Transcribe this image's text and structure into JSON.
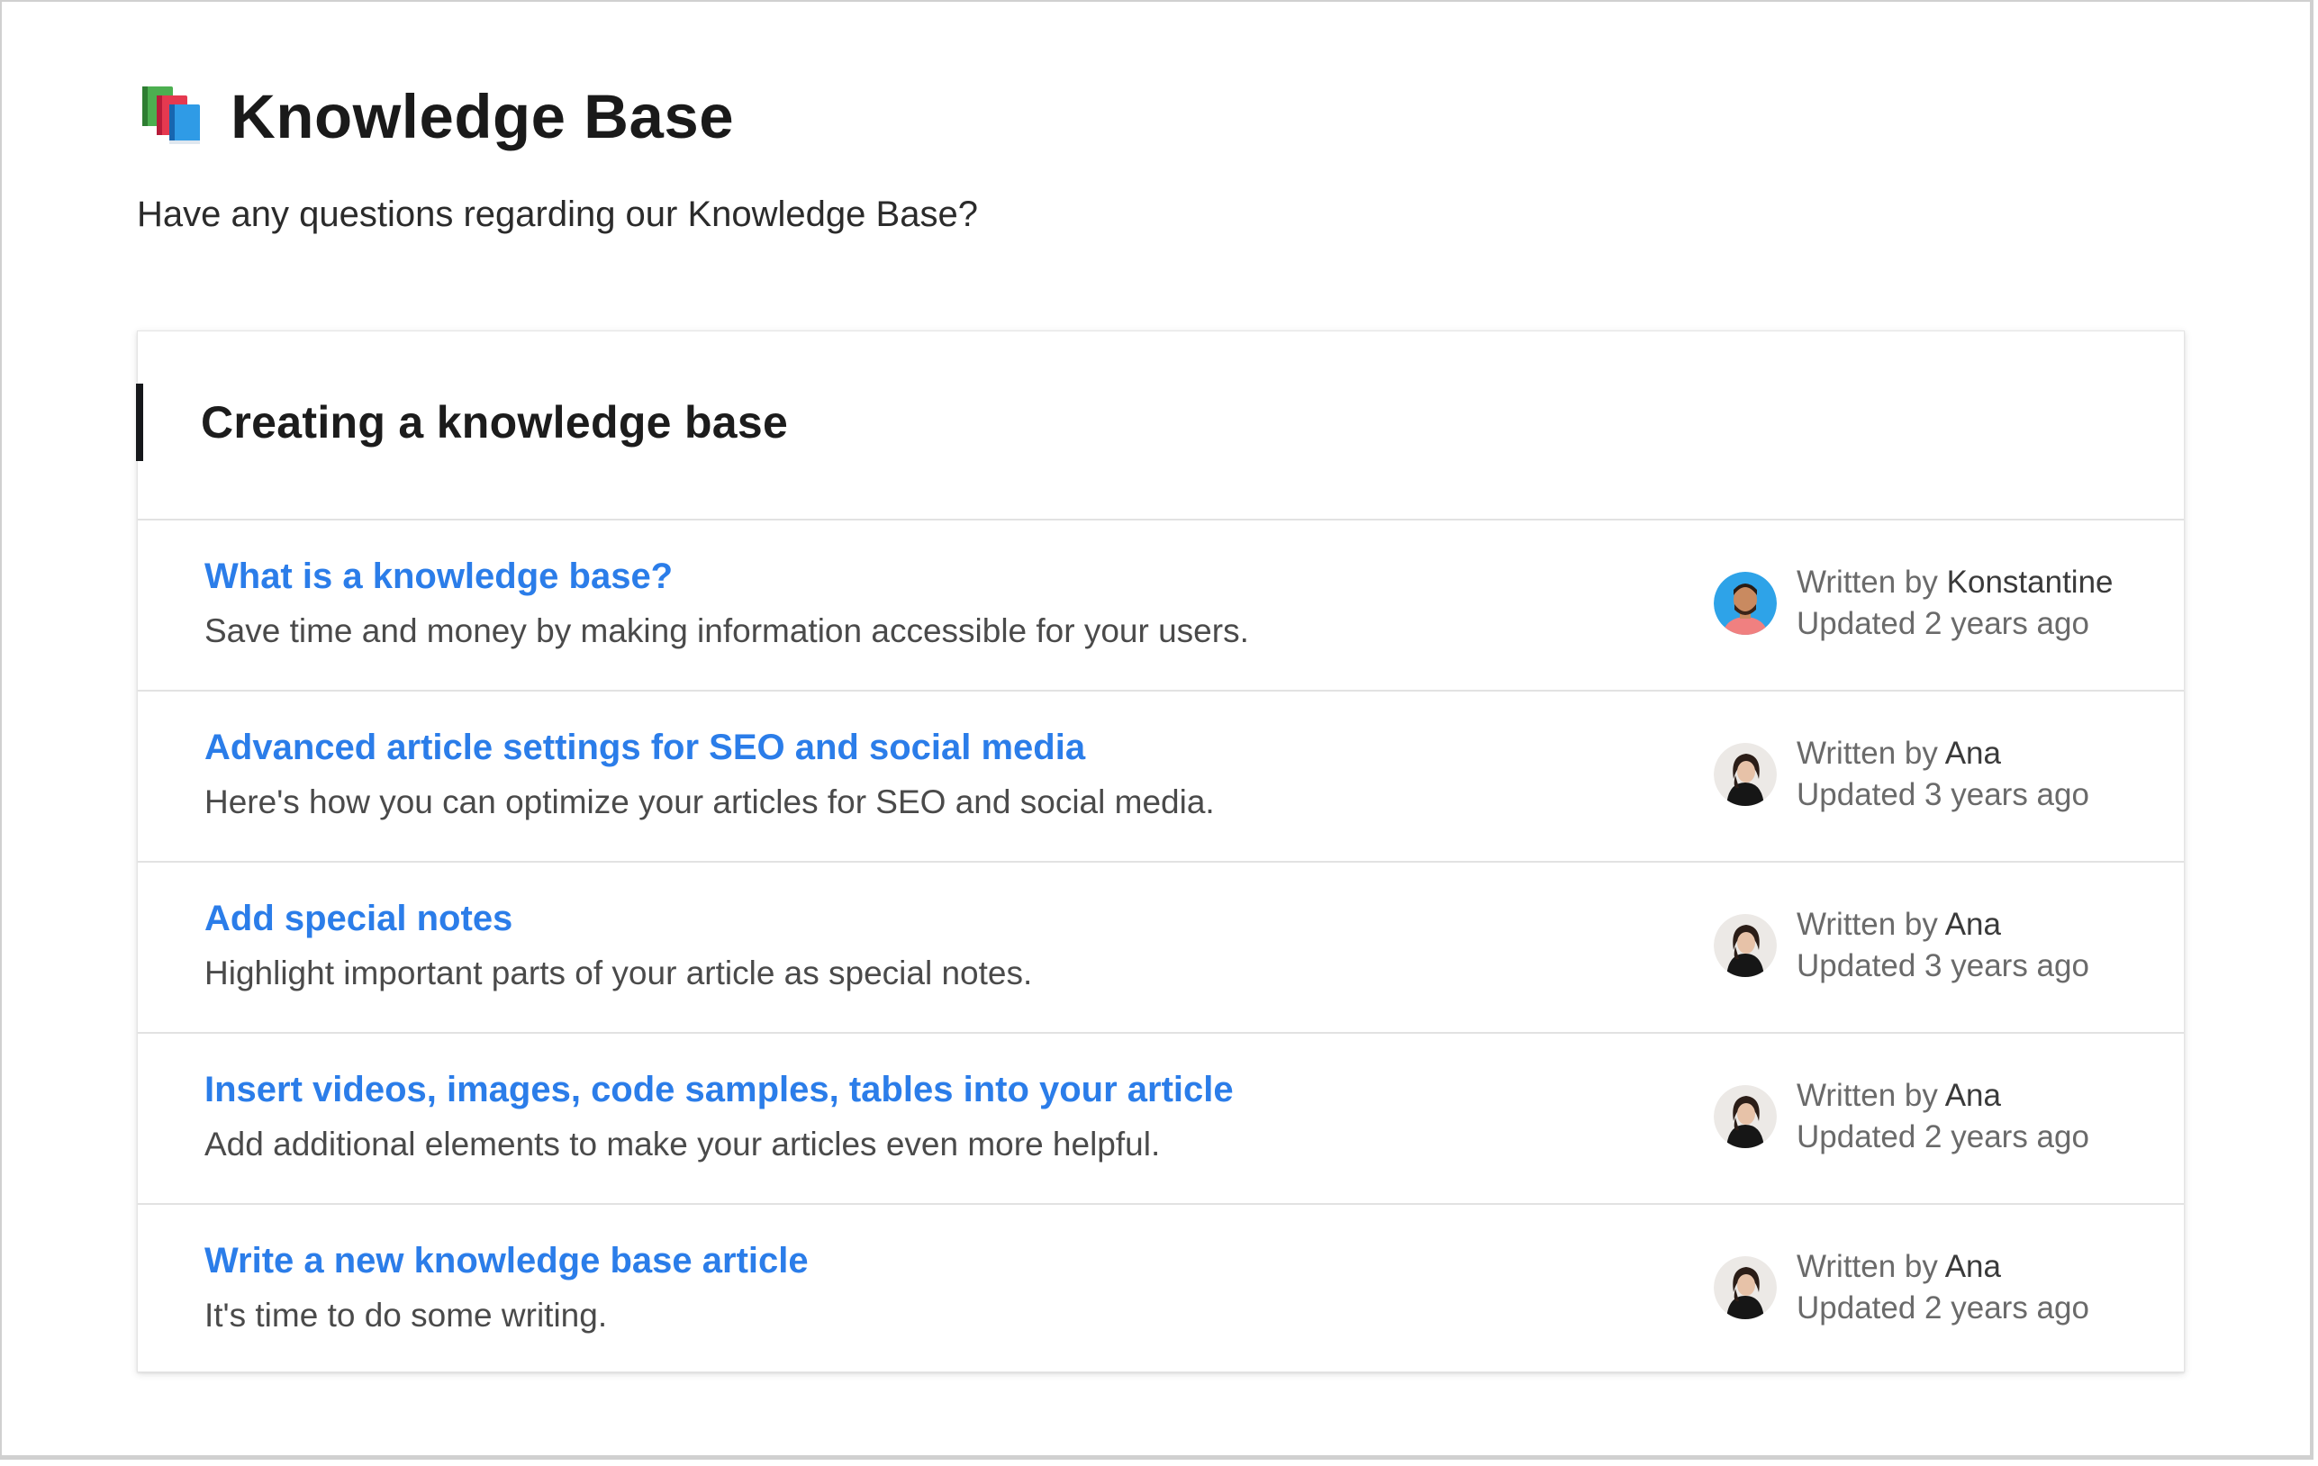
{
  "page": {
    "title": "Knowledge Base",
    "subtitle": "Have any questions regarding our Knowledge Base?",
    "icon": "books-icon"
  },
  "section": {
    "title": "Creating a knowledge base"
  },
  "articles": [
    {
      "title": "What is a knowledge base?",
      "description": "Save time and money by making information accessible for your users.",
      "written_by_label": "Written by",
      "author": "Konstantine",
      "updated": "Updated 2 years ago",
      "avatar": "avatar-konstantine"
    },
    {
      "title": "Advanced article settings for SEO and social media",
      "description": "Here's how you can optimize your articles for SEO and social media.",
      "written_by_label": "Written by",
      "author": "Ana",
      "updated": "Updated 3 years ago",
      "avatar": "avatar-ana"
    },
    {
      "title": "Add special notes",
      "description": "Highlight important parts of your article as special notes.",
      "written_by_label": "Written by",
      "author": "Ana",
      "updated": "Updated 3 years ago",
      "avatar": "avatar-ana"
    },
    {
      "title": "Insert videos, images, code samples, tables into your article",
      "description": "Add additional elements to make your articles even more helpful.",
      "written_by_label": "Written by",
      "author": "Ana",
      "updated": "Updated 2 years ago",
      "avatar": "avatar-ana"
    },
    {
      "title": "Write a new knowledge base article",
      "description": "It's time to do some writing.",
      "written_by_label": "Written by",
      "author": "Ana",
      "updated": "Updated 2 years ago",
      "avatar": "avatar-ana"
    }
  ],
  "colors": {
    "link": "#2b7de9",
    "accent_bar": "#15171a",
    "text_muted": "#6a6a6a"
  }
}
